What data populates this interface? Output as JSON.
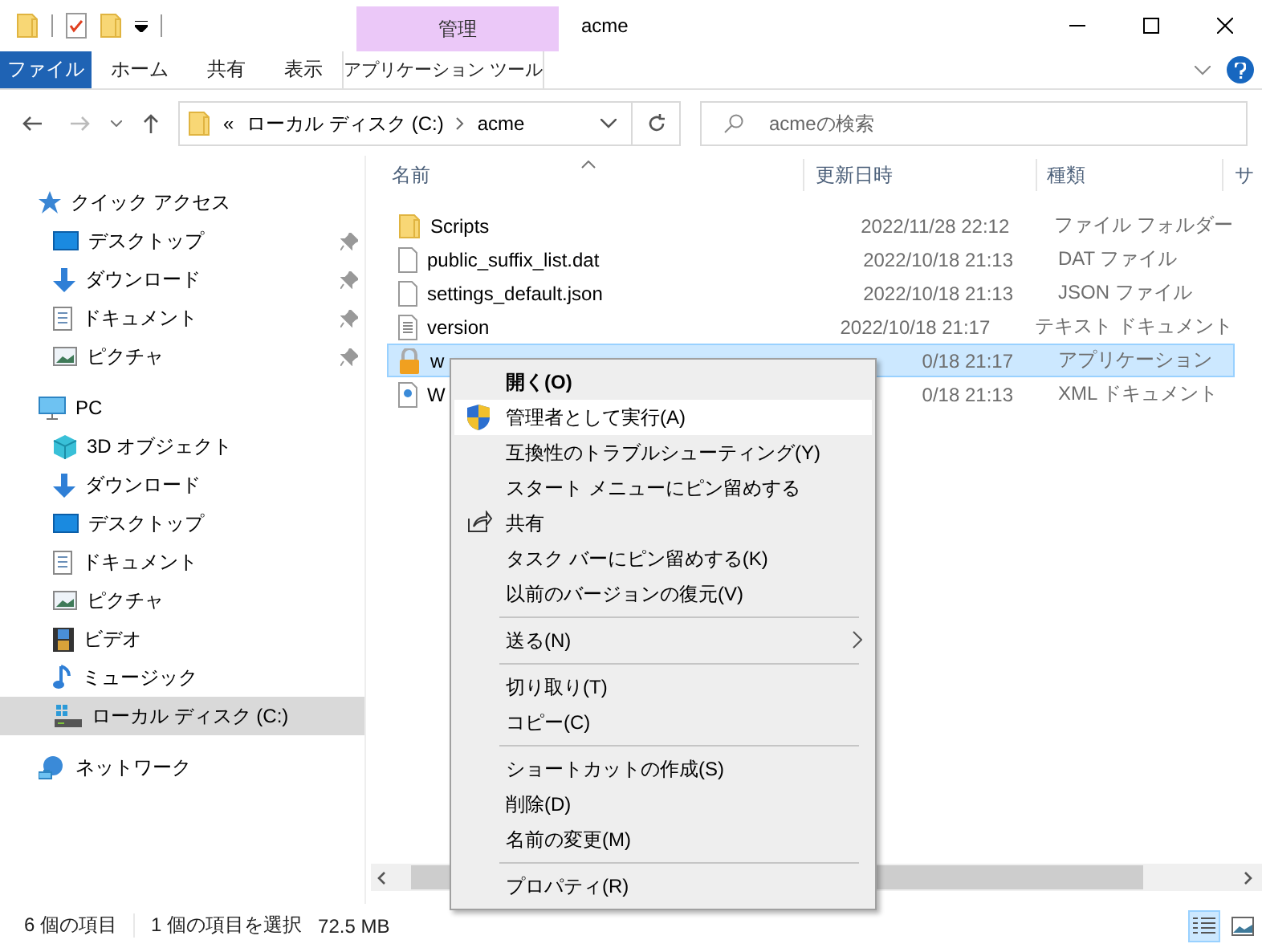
{
  "title_bar": {
    "title": "acme",
    "contextual_header": "管理"
  },
  "ribbon": {
    "file_tab": "ファイル",
    "tabs": [
      {
        "label": "ホーム",
        "selected": false
      },
      {
        "label": "共有",
        "selected": false
      },
      {
        "label": "表示",
        "selected": false
      }
    ],
    "contextual_tab": "アプリケーション ツール"
  },
  "address_bar": {
    "overflow": "«",
    "path": [
      "ローカル ディスク (C:)",
      "acme"
    ]
  },
  "search": {
    "placeholder": "acmeの検索"
  },
  "navigation": [
    {
      "label": "クイック アクセス",
      "kind": "star",
      "selected": false,
      "children": [
        {
          "label": "デスクトップ",
          "kind": "desktop",
          "pinned": true,
          "selected": false
        },
        {
          "label": "ダウンロード",
          "kind": "download",
          "pinned": true,
          "selected": false
        },
        {
          "label": "ドキュメント",
          "kind": "document",
          "pinned": true,
          "selected": false
        },
        {
          "label": "ピクチャ",
          "kind": "picture",
          "pinned": true,
          "selected": false
        }
      ]
    },
    {
      "label": "PC",
      "kind": "pc",
      "selected": false,
      "children": [
        {
          "label": "3D オブジェクト",
          "kind": "cube",
          "pinned": false,
          "selected": false
        },
        {
          "label": "ダウンロード",
          "kind": "download",
          "pinned": false,
          "selected": false
        },
        {
          "label": "デスクトップ",
          "kind": "desktop",
          "pinned": false,
          "selected": false
        },
        {
          "label": "ドキュメント",
          "kind": "document",
          "pinned": false,
          "selected": false
        },
        {
          "label": "ピクチャ",
          "kind": "picture",
          "pinned": false,
          "selected": false
        },
        {
          "label": "ビデオ",
          "kind": "video",
          "pinned": false,
          "selected": false
        },
        {
          "label": "ミュージック",
          "kind": "music",
          "pinned": false,
          "selected": false
        },
        {
          "label": "ローカル ディスク (C:)",
          "kind": "drive",
          "pinned": false,
          "selected": true
        }
      ]
    },
    {
      "label": "ネットワーク",
      "kind": "network",
      "selected": false
    }
  ],
  "columns": [
    {
      "label": "名前",
      "sorted": true
    },
    {
      "label": "更新日時",
      "sorted": false
    },
    {
      "label": "種類",
      "sorted": false
    },
    {
      "label": "サ",
      "sorted": false
    }
  ],
  "files": [
    {
      "name": "Scripts",
      "kind": "folder",
      "modified": "2022/11/28 22:12",
      "type": "ファイル フォルダー",
      "selected": false
    },
    {
      "name": "public_suffix_list.dat",
      "kind": "file",
      "modified": "2022/10/18 21:13",
      "type": "DAT ファイル",
      "selected": false
    },
    {
      "name": "settings_default.json",
      "kind": "file",
      "modified": "2022/10/18 21:13",
      "type": "JSON ファイル",
      "selected": false
    },
    {
      "name": "version",
      "kind": "text",
      "modified": "2022/10/18 21:17",
      "type": "テキスト ドキュメント",
      "selected": false
    },
    {
      "name": "w",
      "kind": "app",
      "modified": "0/18 21:17",
      "type": "アプリケーション",
      "selected": true
    },
    {
      "name": "W",
      "kind": "xml",
      "modified": "0/18 21:13",
      "type": "XML ドキュメント",
      "selected": false
    }
  ],
  "context_menu": [
    {
      "kind": "item",
      "label": "開く(O)",
      "default": true,
      "selected": false
    },
    {
      "kind": "shield-item",
      "label": "管理者として実行(A)",
      "default": false,
      "selected": true
    },
    {
      "kind": "item",
      "label": "互換性のトラブルシューティング(Y)",
      "default": false,
      "selected": false
    },
    {
      "kind": "item",
      "label": "スタート メニューにピン留めする",
      "default": false,
      "selected": false
    },
    {
      "kind": "share-item",
      "label": "共有",
      "default": false,
      "selected": false
    },
    {
      "kind": "item",
      "label": "タスク バーにピン留めする(K)",
      "default": false,
      "selected": false
    },
    {
      "kind": "item",
      "label": "以前のバージョンの復元(V)",
      "default": false,
      "selected": false
    },
    {
      "kind": "separator"
    },
    {
      "kind": "submenu-item",
      "label": "送る(N)",
      "default": false,
      "selected": false
    },
    {
      "kind": "separator"
    },
    {
      "kind": "item",
      "label": "切り取り(T)",
      "default": false,
      "selected": false
    },
    {
      "kind": "item",
      "label": "コピー(C)",
      "default": false,
      "selected": false
    },
    {
      "kind": "separator"
    },
    {
      "kind": "item",
      "label": "ショートカットの作成(S)",
      "default": false,
      "selected": false
    },
    {
      "kind": "item",
      "label": "削除(D)",
      "default": false,
      "selected": false
    },
    {
      "kind": "item",
      "label": "名前の変更(M)",
      "default": false,
      "selected": false
    },
    {
      "kind": "separator"
    },
    {
      "kind": "item",
      "label": "プロパティ(R)",
      "default": false,
      "selected": false
    }
  ],
  "status_bar": {
    "item_count": "6 個の項目",
    "selection": "1 個の項目を選択",
    "size": "72.5 MB"
  },
  "view_buttons": [
    {
      "kind": "details",
      "selected": true
    },
    {
      "kind": "large-icons",
      "selected": false
    }
  ]
}
